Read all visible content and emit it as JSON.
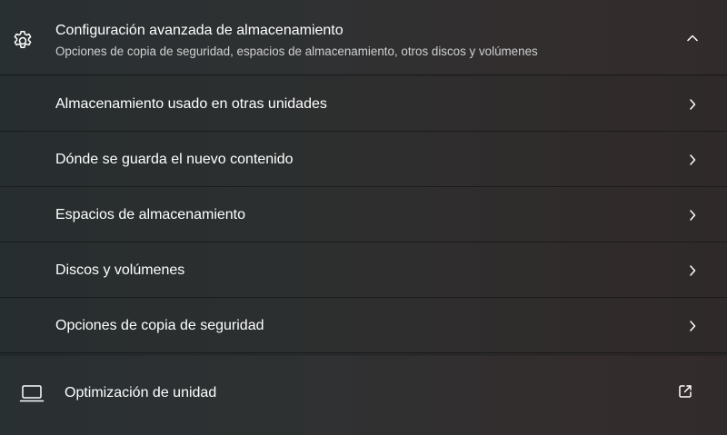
{
  "section": {
    "title": "Configuración avanzada de almacenamiento",
    "subtitle": "Opciones de copia de seguridad, espacios de almacenamiento, otros discos y volúmenes",
    "icon": "gear-icon",
    "expanded": true
  },
  "items": [
    {
      "label": "Almacenamiento usado en otras unidades"
    },
    {
      "label": "Dónde se guarda el nuevo contenido"
    },
    {
      "label": "Espacios de almacenamiento"
    },
    {
      "label": "Discos y volúmenes"
    },
    {
      "label": "Opciones de copia de seguridad"
    }
  ],
  "footer": {
    "label": "Optimización de unidad",
    "icon": "laptop-icon",
    "action_icon": "external-link-icon"
  },
  "colors": {
    "text": "#ffffff",
    "subtext": "#cfd0d1",
    "divider": "#1a1b1c"
  }
}
